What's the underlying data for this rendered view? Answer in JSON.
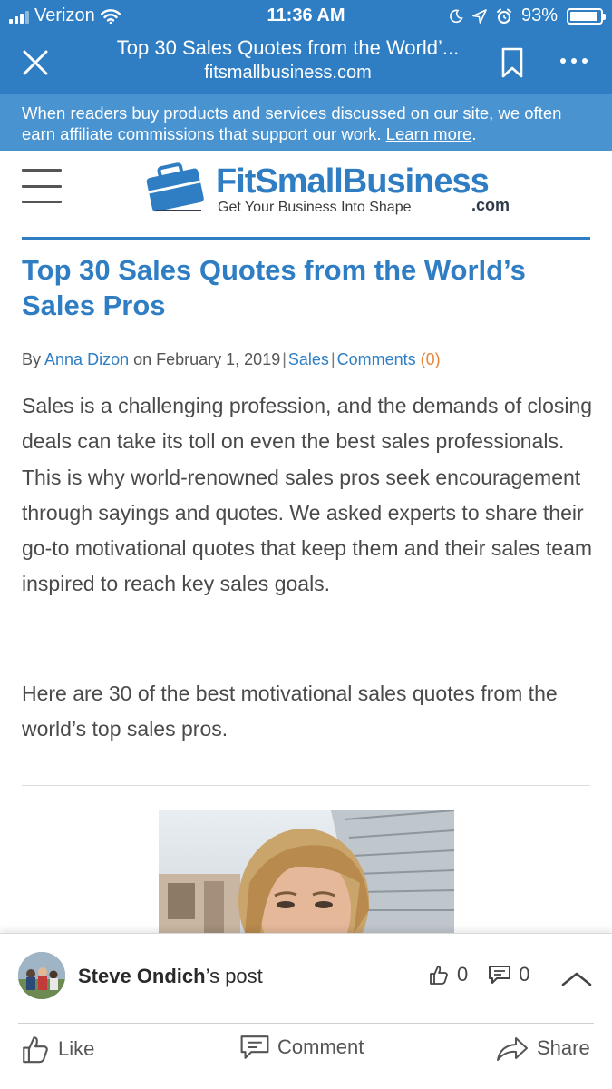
{
  "status_bar": {
    "carrier": "Verizon",
    "time": "11:36 AM",
    "battery_percent": "93%",
    "battery_level": 0.93
  },
  "browser": {
    "title": "Top 30 Sales Quotes from the World’...",
    "url": "fitsmallbusiness.com"
  },
  "notice": {
    "text": "When readers buy products and services discussed on our site, we often earn affiliate commissions that support our work.",
    "link": "Learn more",
    "end": "."
  },
  "site": {
    "logo_name": "FitSmallBusiness",
    "logo_tagline": "Get Your Business Into Shape",
    "logo_com": ".com"
  },
  "article": {
    "title": "Top 30 Sales Quotes from the World’s Sales Pros",
    "byline": {
      "by": "By",
      "author": "Anna Dizon",
      "on_date": "on February 1, 2019",
      "sep": "|",
      "category": "Sales",
      "comments_label": "Comments",
      "comments_count": "(0)"
    },
    "paragraph1": "Sales is a challenging profession, and the demands of closing deals can take its toll on even the best sales professionals. This is why world-renowned sales pros seek encouragement through sayings and quotes. We asked experts to share their go-to motivational quotes that keep them and their sales team inspired to reach key sales goals.",
    "paragraph2": "Here are 30 of the best motivational sales quotes from the world’s top sales pros."
  },
  "post_bar": {
    "author": "Steve Ondich",
    "suffix": "’s post",
    "likes": "0",
    "comments": "0",
    "actions": {
      "like": "Like",
      "comment": "Comment",
      "share": "Share"
    }
  },
  "colors": {
    "brand_blue": "#2f7ec4",
    "notice_blue": "#4a93d1",
    "comment_count_orange": "#e8843a"
  }
}
